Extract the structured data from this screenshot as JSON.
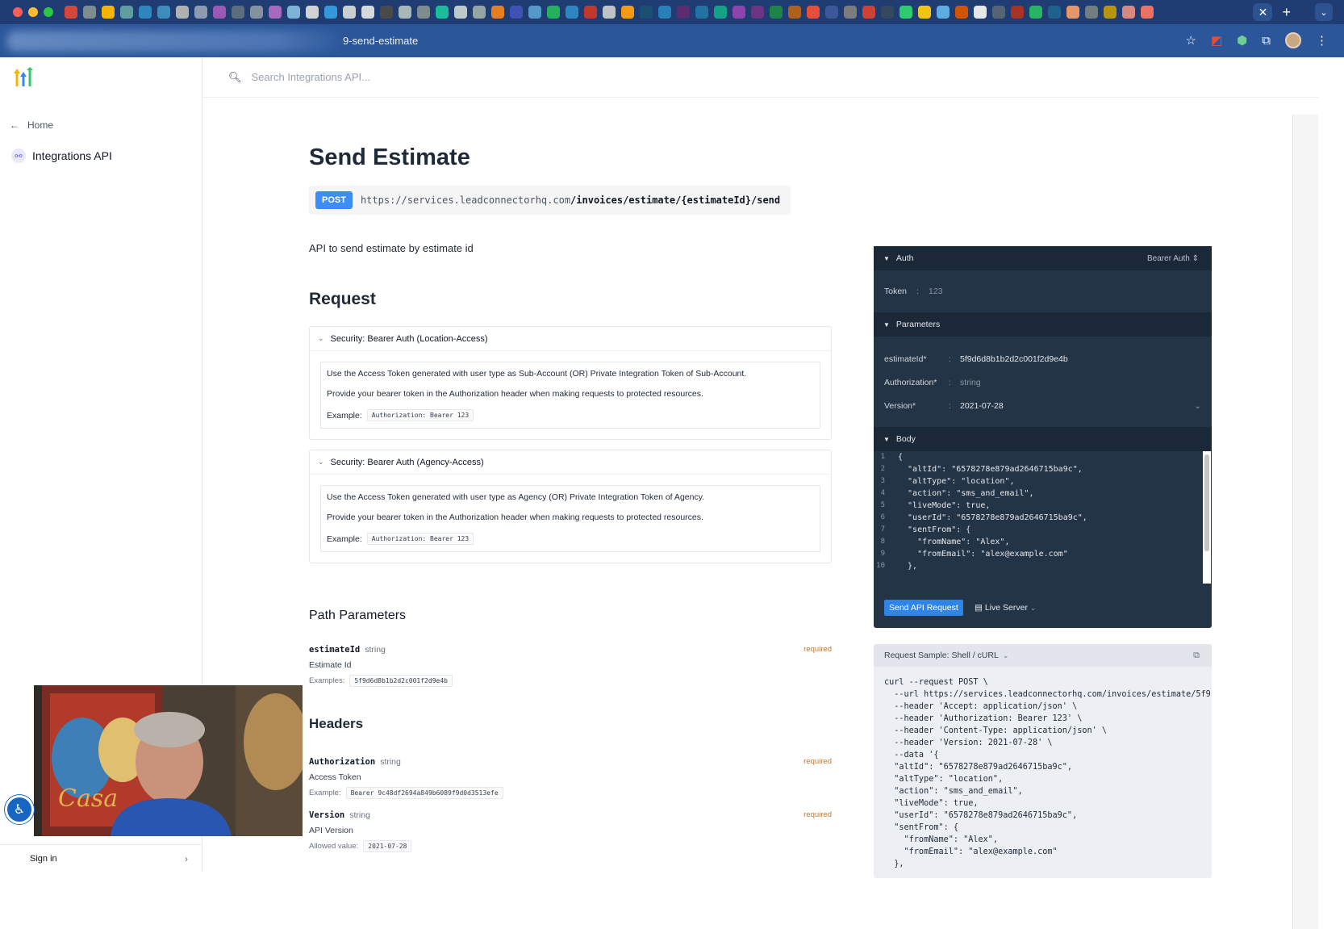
{
  "browser": {
    "url_tail": "9-send-estimate",
    "favicons": [
      "#d44638",
      "#7f8c8d",
      "#f4b400",
      "#5f9ea0",
      "#2e86c1",
      "#3c8dbc",
      "#b0b0b0",
      "#8e9aaf",
      "#9b59b6",
      "#5d6d7e",
      "#85929e",
      "#a569bd",
      "#7fb3d5",
      "#d0d3d4",
      "#3498db",
      "#cacfd2",
      "#d5d8dc",
      "#4a4a4a",
      "#aab7b8",
      "#7f8c8d",
      "#1abc9c",
      "#bfc9ca",
      "#95a5a6",
      "#e67e22",
      "#3f51b5",
      "#5499c7",
      "#27ae60",
      "#2e86c1",
      "#c0392b",
      "#bdc3c7",
      "#f39c12",
      "#1b4f72",
      "#2980b9",
      "#5b2c6f",
      "#2471a3",
      "#16a085",
      "#8e44ad",
      "#6c3483",
      "#1e8449",
      "#af601a",
      "#e74c3c",
      "#3b5998",
      "#7b7d7d",
      "#cb4335",
      "#34495e",
      "#2ecc71",
      "#f1c40f",
      "#5dade2",
      "#d35400",
      "#e5e8e8",
      "#566573",
      "#a93226",
      "#28b463",
      "#1f618d",
      "#e59866",
      "#717d7e",
      "#b7950b",
      "#d98880",
      "#ec7063"
    ]
  },
  "search": {
    "placeholder": "Search Integrations API..."
  },
  "sidebar": {
    "home": "Home",
    "api_name": "Integrations API",
    "signin": "Sign in"
  },
  "main": {
    "title": "Send Estimate",
    "method": "POST",
    "url_base": "https://services.leadconnectorhq.com",
    "url_path": "/invoices/estimate/{estimateId}/send",
    "description": "API to send estimate by estimate id",
    "request_heading": "Request",
    "security": [
      {
        "title": "Security: Bearer Auth (Location-Access)",
        "line1": "Use the Access Token generated with user type as Sub-Account (OR) Private Integration Token of Sub-Account.",
        "line2": "Provide your bearer token in the Authorization header when making requests to protected resources.",
        "example_label": "Example:",
        "example": "Authorization: Bearer 123"
      },
      {
        "title": "Security: Bearer Auth (Agency-Access)",
        "line1": "Use the Access Token generated with user type as Agency (OR) Private Integration Token of Agency.",
        "line2": "Provide your bearer token in the Authorization header when making requests to protected resources.",
        "example_label": "Example:",
        "example": "Authorization: Bearer 123"
      }
    ],
    "path_params_heading": "Path Parameters",
    "path_param": {
      "name": "estimateId",
      "type": "string",
      "required": "required",
      "desc": "Estimate Id",
      "example_label": "Examples:",
      "example": "5f9d6d8b1b2d2c001f2d9e4b"
    },
    "headers_heading": "Headers",
    "headers": [
      {
        "name": "Authorization",
        "type": "string",
        "required": "required",
        "desc": "Access Token",
        "example_label": "Example:",
        "example": "Bearer 9c48df2694a849b6089f9d0d3513efe"
      },
      {
        "name": "Version",
        "type": "string",
        "required": "required",
        "desc": "API Version",
        "example_label": "Allowed value:",
        "example": "2021-07-28"
      }
    ]
  },
  "panel": {
    "auth_label": "Auth",
    "auth_type": "Bearer Auth",
    "token_label": "Token",
    "token_value": "123",
    "params_label": "Parameters",
    "params": [
      {
        "key": "estimateId*",
        "value": "5f9d6d8b1b2d2c001f2d9e4b"
      },
      {
        "key": "Authorization*",
        "value": "string"
      },
      {
        "key": "Version*",
        "value": "2021-07-28"
      }
    ],
    "body_label": "Body",
    "body_lines": [
      "{",
      "  \"altId\": \"6578278e879ad2646715ba9c\",",
      "  \"altType\": \"location\",",
      "  \"action\": \"sms_and_email\",",
      "  \"liveMode\": true,",
      "  \"userId\": \"6578278e879ad2646715ba9c\",",
      "  \"sentFrom\": {",
      "    \"fromName\": \"Alex\",",
      "    \"fromEmail\": \"alex@example.com\"",
      "  },"
    ],
    "send_button": "Send API Request",
    "server": "Live Server"
  },
  "sample": {
    "title": "Request Sample: Shell / cURL",
    "code": "curl --request POST \\\n  --url https://services.leadconnectorhq.com/invoices/estimate/5f9\n  --header 'Accept: application/json' \\\n  --header 'Authorization: Bearer 123' \\\n  --header 'Content-Type: application/json' \\\n  --header 'Version: 2021-07-28' \\\n  --data '{\n  \"altId\": \"6578278e879ad2646715ba9c\",\n  \"altType\": \"location\",\n  \"action\": \"sms_and_email\",\n  \"liveMode\": true,\n  \"userId\": \"6578278e879ad2646715ba9c\",\n  \"sentFrom\": {\n    \"fromName\": \"Alex\",\n    \"fromEmail\": \"alex@example.com\"\n  },"
  }
}
